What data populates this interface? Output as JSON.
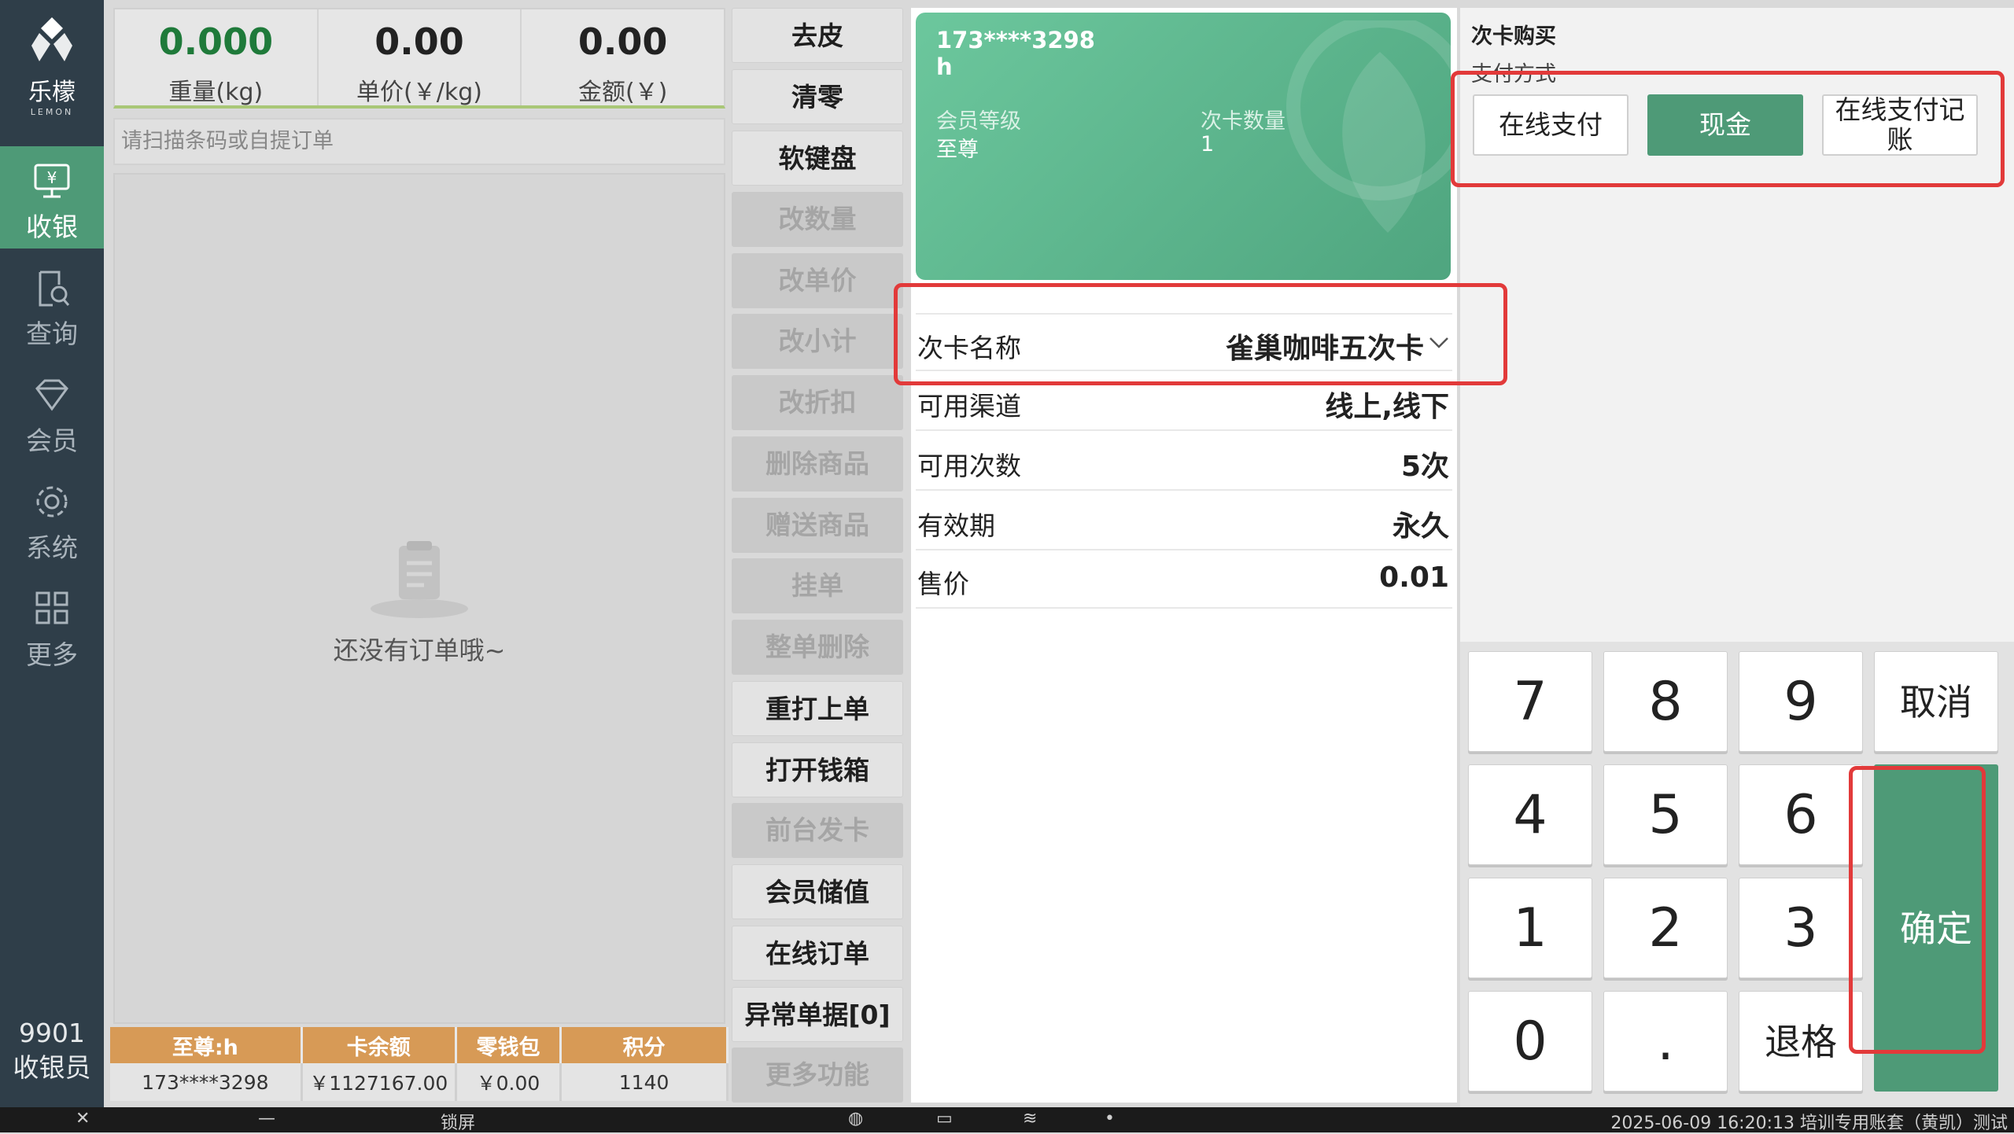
{
  "app": {
    "logo_cn": "乐檬",
    "logo_en": "LEMON"
  },
  "nav": {
    "items": [
      {
        "label": "收银",
        "icon": "cashier-icon"
      },
      {
        "label": "查询",
        "icon": "search-doc-icon"
      },
      {
        "label": "会员",
        "icon": "diamond-icon"
      },
      {
        "label": "系统",
        "icon": "gear-icon"
      },
      {
        "label": "更多",
        "icon": "grid-icon"
      }
    ],
    "user_id": "9901",
    "user_role": "收银员"
  },
  "scale": {
    "weight": "0.000",
    "weight_label": "重量(kg)",
    "unit_price": "0.00",
    "unit_price_label": "单价(￥/kg)",
    "amount": "0.00",
    "amount_label": "金额(￥)"
  },
  "scan": {
    "placeholder": "请扫描条码或自提订单"
  },
  "orders": {
    "empty_text": "还没有订单哦~"
  },
  "member_bar": {
    "headers": [
      "至尊:h",
      "卡余额",
      "零钱包",
      "积分"
    ],
    "values": [
      "173****3298",
      "￥1127167.00",
      "￥0.00",
      "1140"
    ]
  },
  "functions": [
    {
      "label": "去皮",
      "enabled": true
    },
    {
      "label": "清零",
      "enabled": true
    },
    {
      "label": "软键盘",
      "enabled": true
    },
    {
      "label": "改数量",
      "enabled": false
    },
    {
      "label": "改单价",
      "enabled": false
    },
    {
      "label": "改小计",
      "enabled": false
    },
    {
      "label": "改折扣",
      "enabled": false
    },
    {
      "label": "删除商品",
      "enabled": false
    },
    {
      "label": "赠送商品",
      "enabled": false
    },
    {
      "label": "挂单",
      "enabled": false
    },
    {
      "label": "整单删除",
      "enabled": false
    },
    {
      "label": "重打上单",
      "enabled": true
    },
    {
      "label": "打开钱箱",
      "enabled": true
    },
    {
      "label": "前台发卡",
      "enabled": false
    },
    {
      "label": "会员储值",
      "enabled": true
    },
    {
      "label": "在线订单",
      "enabled": true
    },
    {
      "label": "异常单据[0]",
      "enabled": true
    },
    {
      "label": "更多功能",
      "enabled": false
    }
  ],
  "card": {
    "phone": "173****3298",
    "name": "h",
    "level_label": "会员等级",
    "level": "至尊",
    "count_label": "次卡数量",
    "count": "1"
  },
  "card_info": [
    {
      "key": "次卡名称",
      "value": "雀巢咖啡五次卡",
      "selectable": true
    },
    {
      "key": "可用渠道",
      "value": "线上,线下"
    },
    {
      "key": "可用次数",
      "value": "5次"
    },
    {
      "key": "有效期",
      "value": "永久"
    },
    {
      "key": "售价",
      "value": "0.01"
    }
  ],
  "purchase": {
    "title": "次卡购买",
    "pay_method_label": "支付方式",
    "methods": [
      {
        "label": "在线支付",
        "active": false
      },
      {
        "label": "现金",
        "active": true
      },
      {
        "label": "在线支付记账",
        "active": false
      }
    ]
  },
  "keypad": {
    "keys": [
      "7",
      "8",
      "9",
      "取消",
      "4",
      "5",
      "6",
      "1",
      "2",
      "3",
      "0",
      ".",
      "退格"
    ],
    "confirm": "确定"
  },
  "taskbar": {
    "lock": "锁屏",
    "status": "2025-06-09 16:20:13 培训专用账套（黄凯）测试"
  },
  "colors": {
    "brand_green": "#4e9a77",
    "member_header": "#d79a56",
    "annotation_red": "#e23a3a"
  }
}
